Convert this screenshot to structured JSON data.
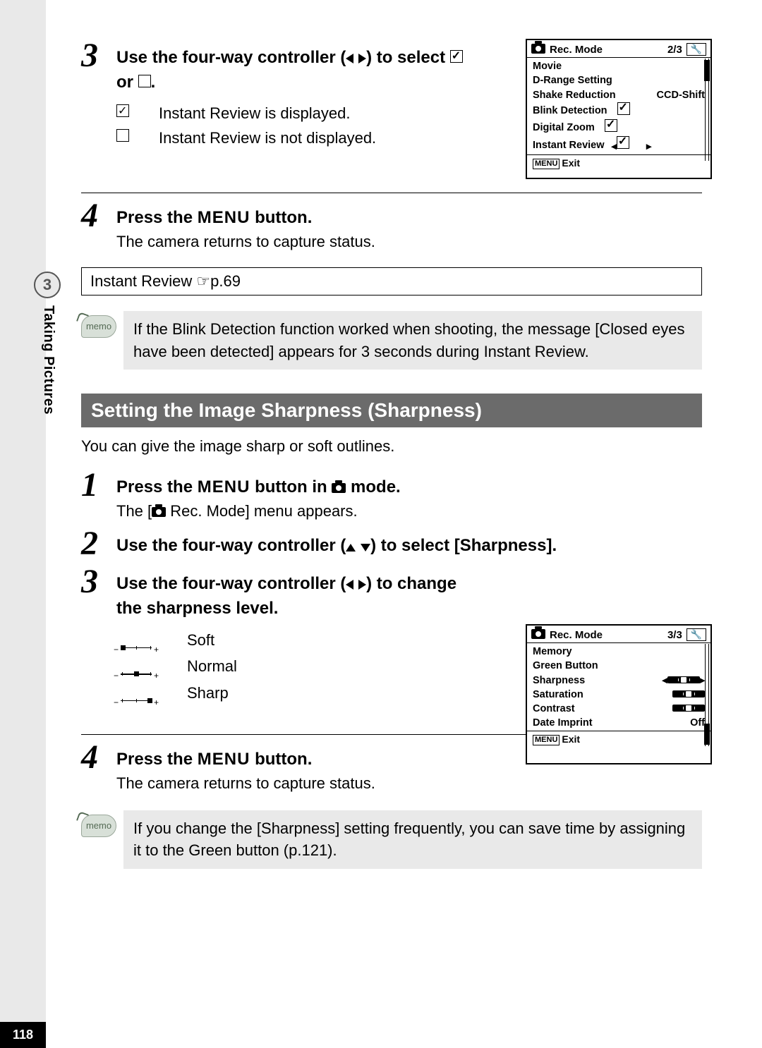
{
  "page_number": "118",
  "sidebar": {
    "chapter_number": "3",
    "chapter_title": "Taking Pictures"
  },
  "upper": {
    "step3": {
      "num": "3",
      "title_a": "Use the four-way controller (",
      "title_b": ") to select ",
      "title_c": " or ",
      "title_d": ".",
      "opt_on": "Instant Review is displayed.",
      "opt_off": "Instant Review is not displayed."
    },
    "step4": {
      "num": "4",
      "title_a": "Press the ",
      "menu_word": "MENU",
      "title_b": " button.",
      "desc": "The camera returns to capture status."
    },
    "xref": "Instant Review ☞p.69",
    "memo": "If the Blink Detection function worked when shooting, the message [Closed eyes have been detected] appears for 3 seconds during Instant Review.",
    "memo_label": "memo",
    "screen": {
      "title": "Rec. Mode",
      "page": "2/3",
      "items": {
        "movie": "Movie",
        "drange": "D-Range Setting",
        "shake_l": "Shake Reduction",
        "shake_v": "CCD-Shift",
        "blink": "Blink Detection",
        "zoom": "Digital Zoom",
        "instant": "Instant Review"
      },
      "exit_menu": "MENU",
      "exit": "Exit"
    }
  },
  "section_title": "Setting the Image Sharpness (Sharpness)",
  "intro": "You can give the image sharp or soft outlines.",
  "lower": {
    "step1": {
      "num": "1",
      "title_a": "Press the ",
      "menu_word": "MENU",
      "title_b": " button in ",
      "title_c": " mode.",
      "desc_a": "The [",
      "desc_b": " Rec. Mode] menu appears."
    },
    "step2": {
      "num": "2",
      "title_a": "Use the four-way controller (",
      "title_b": ") to select [Sharpness]."
    },
    "step3": {
      "num": "3",
      "title_a": "Use the four-way controller (",
      "title_b": ") to change the sharpness level.",
      "levels": {
        "soft": "Soft",
        "normal": "Normal",
        "sharp": "Sharp"
      }
    },
    "step4": {
      "num": "4",
      "title_a": "Press the ",
      "menu_word": "MENU",
      "title_b": " button.",
      "desc": "The camera returns to capture status."
    },
    "memo": "If you change the [Sharpness] setting frequently, you can save time by assigning it to the Green button (p.121).",
    "memo_label": "memo",
    "screen": {
      "title": "Rec. Mode",
      "page": "3/3",
      "items": {
        "memory": "Memory",
        "green": "Green Button",
        "sharpness": "Sharpness",
        "saturation": "Saturation",
        "contrast": "Contrast",
        "date_l": "Date Imprint",
        "date_v": "Off"
      },
      "exit_menu": "MENU",
      "exit": "Exit"
    }
  }
}
